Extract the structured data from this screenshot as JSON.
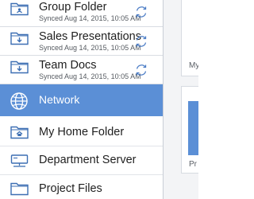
{
  "synced_folders": [
    {
      "name": "Group Folder",
      "synced": "Synced Aug 14, 2015, 10:05 AM",
      "icon": "folder-shared-icon"
    },
    {
      "name": "Sales Presentations",
      "synced": "Synced Aug 14, 2015, 10:05 AM",
      "icon": "folder-download-icon"
    },
    {
      "name": "Team Docs",
      "synced": "Synced Aug 14, 2015, 10:05 AM",
      "icon": "folder-download-icon"
    }
  ],
  "network": {
    "label": "Network",
    "icon": "globe-icon"
  },
  "locations": [
    {
      "name": "My Home Folder",
      "icon": "folder-home-icon"
    },
    {
      "name": "Department Server",
      "icon": "server-icon"
    },
    {
      "name": "Project Files",
      "icon": "folder-icon"
    }
  ],
  "right_pane": {
    "tile_labels": [
      "My H",
      "Pr"
    ]
  },
  "colors": {
    "accent": "#5b8fd6",
    "icon_stroke": "#3d6fb3",
    "divider": "#d9dde3",
    "pane_bg": "#f3f4f6"
  }
}
